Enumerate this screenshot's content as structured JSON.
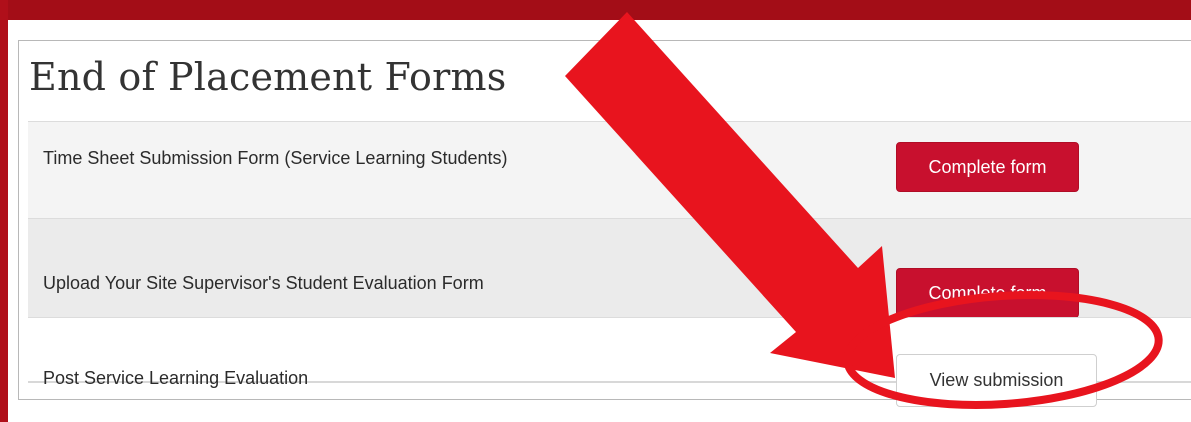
{
  "panel": {
    "title": "End of Placement Forms"
  },
  "forms": [
    {
      "label": "Time Sheet Submission Form (Service Learning Students)",
      "button": "Complete form"
    },
    {
      "label": "Upload Your Site Supervisor's Student Evaluation Form",
      "button": "Complete form"
    },
    {
      "label": "Post Service Learning Evaluation",
      "button": "View submission"
    }
  ],
  "colors": {
    "accent": "#c8102e",
    "frame": "#a30d17",
    "annotation": "#e8141e"
  },
  "annotation": {
    "arrow_icon": "arrow-icon",
    "circle_icon": "highlight-circle-icon"
  }
}
